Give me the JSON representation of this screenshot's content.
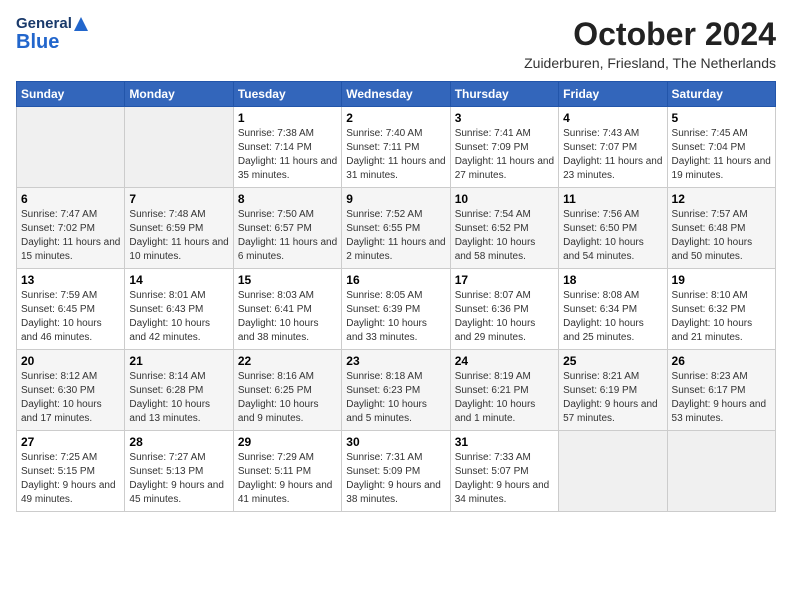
{
  "header": {
    "logo_general": "General",
    "logo_blue": "Blue",
    "title": "October 2024",
    "subtitle": "Zuiderburen, Friesland, The Netherlands"
  },
  "calendar": {
    "days_of_week": [
      "Sunday",
      "Monday",
      "Tuesday",
      "Wednesday",
      "Thursday",
      "Friday",
      "Saturday"
    ],
    "weeks": [
      [
        {
          "day": "",
          "info": ""
        },
        {
          "day": "",
          "info": ""
        },
        {
          "day": "1",
          "info": "Sunrise: 7:38 AM\nSunset: 7:14 PM\nDaylight: 11 hours and 35 minutes."
        },
        {
          "day": "2",
          "info": "Sunrise: 7:40 AM\nSunset: 7:11 PM\nDaylight: 11 hours and 31 minutes."
        },
        {
          "day": "3",
          "info": "Sunrise: 7:41 AM\nSunset: 7:09 PM\nDaylight: 11 hours and 27 minutes."
        },
        {
          "day": "4",
          "info": "Sunrise: 7:43 AM\nSunset: 7:07 PM\nDaylight: 11 hours and 23 minutes."
        },
        {
          "day": "5",
          "info": "Sunrise: 7:45 AM\nSunset: 7:04 PM\nDaylight: 11 hours and 19 minutes."
        }
      ],
      [
        {
          "day": "6",
          "info": "Sunrise: 7:47 AM\nSunset: 7:02 PM\nDaylight: 11 hours and 15 minutes."
        },
        {
          "day": "7",
          "info": "Sunrise: 7:48 AM\nSunset: 6:59 PM\nDaylight: 11 hours and 10 minutes."
        },
        {
          "day": "8",
          "info": "Sunrise: 7:50 AM\nSunset: 6:57 PM\nDaylight: 11 hours and 6 minutes."
        },
        {
          "day": "9",
          "info": "Sunrise: 7:52 AM\nSunset: 6:55 PM\nDaylight: 11 hours and 2 minutes."
        },
        {
          "day": "10",
          "info": "Sunrise: 7:54 AM\nSunset: 6:52 PM\nDaylight: 10 hours and 58 minutes."
        },
        {
          "day": "11",
          "info": "Sunrise: 7:56 AM\nSunset: 6:50 PM\nDaylight: 10 hours and 54 minutes."
        },
        {
          "day": "12",
          "info": "Sunrise: 7:57 AM\nSunset: 6:48 PM\nDaylight: 10 hours and 50 minutes."
        }
      ],
      [
        {
          "day": "13",
          "info": "Sunrise: 7:59 AM\nSunset: 6:45 PM\nDaylight: 10 hours and 46 minutes."
        },
        {
          "day": "14",
          "info": "Sunrise: 8:01 AM\nSunset: 6:43 PM\nDaylight: 10 hours and 42 minutes."
        },
        {
          "day": "15",
          "info": "Sunrise: 8:03 AM\nSunset: 6:41 PM\nDaylight: 10 hours and 38 minutes."
        },
        {
          "day": "16",
          "info": "Sunrise: 8:05 AM\nSunset: 6:39 PM\nDaylight: 10 hours and 33 minutes."
        },
        {
          "day": "17",
          "info": "Sunrise: 8:07 AM\nSunset: 6:36 PM\nDaylight: 10 hours and 29 minutes."
        },
        {
          "day": "18",
          "info": "Sunrise: 8:08 AM\nSunset: 6:34 PM\nDaylight: 10 hours and 25 minutes."
        },
        {
          "day": "19",
          "info": "Sunrise: 8:10 AM\nSunset: 6:32 PM\nDaylight: 10 hours and 21 minutes."
        }
      ],
      [
        {
          "day": "20",
          "info": "Sunrise: 8:12 AM\nSunset: 6:30 PM\nDaylight: 10 hours and 17 minutes."
        },
        {
          "day": "21",
          "info": "Sunrise: 8:14 AM\nSunset: 6:28 PM\nDaylight: 10 hours and 13 minutes."
        },
        {
          "day": "22",
          "info": "Sunrise: 8:16 AM\nSunset: 6:25 PM\nDaylight: 10 hours and 9 minutes."
        },
        {
          "day": "23",
          "info": "Sunrise: 8:18 AM\nSunset: 6:23 PM\nDaylight: 10 hours and 5 minutes."
        },
        {
          "day": "24",
          "info": "Sunrise: 8:19 AM\nSunset: 6:21 PM\nDaylight: 10 hours and 1 minute."
        },
        {
          "day": "25",
          "info": "Sunrise: 8:21 AM\nSunset: 6:19 PM\nDaylight: 9 hours and 57 minutes."
        },
        {
          "day": "26",
          "info": "Sunrise: 8:23 AM\nSunset: 6:17 PM\nDaylight: 9 hours and 53 minutes."
        }
      ],
      [
        {
          "day": "27",
          "info": "Sunrise: 7:25 AM\nSunset: 5:15 PM\nDaylight: 9 hours and 49 minutes."
        },
        {
          "day": "28",
          "info": "Sunrise: 7:27 AM\nSunset: 5:13 PM\nDaylight: 9 hours and 45 minutes."
        },
        {
          "day": "29",
          "info": "Sunrise: 7:29 AM\nSunset: 5:11 PM\nDaylight: 9 hours and 41 minutes."
        },
        {
          "day": "30",
          "info": "Sunrise: 7:31 AM\nSunset: 5:09 PM\nDaylight: 9 hours and 38 minutes."
        },
        {
          "day": "31",
          "info": "Sunrise: 7:33 AM\nSunset: 5:07 PM\nDaylight: 9 hours and 34 minutes."
        },
        {
          "day": "",
          "info": ""
        },
        {
          "day": "",
          "info": ""
        }
      ]
    ]
  }
}
